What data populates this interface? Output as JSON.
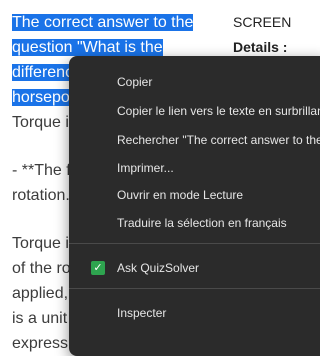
{
  "content": {
    "selected_lines": [
      "The correct answer to the",
      "question \"What is the",
      "differenc",
      "horsepo"
    ],
    "body_lines": [
      "Torque is",
      "- **The f",
      "rotation.",
      "Torque is",
      "of the ro",
      "applied,",
      "is a unit",
      "express the rate at which"
    ]
  },
  "right_column": {
    "label": "SCREEN",
    "details": "Details :"
  },
  "context_menu": {
    "items": [
      "Copier",
      "Copier le lien vers le texte en surbrillance",
      "Rechercher \"The correct answer to the...\"",
      "Imprimer...",
      "Ouvrir en mode Lecture",
      "Traduire la sélection en français",
      "Ask QuizSolver",
      "Inspecter"
    ],
    "accent_color": "#2ea44f"
  },
  "colors": {
    "selection": "#1a73e8",
    "menu_background": "#2b2b2b"
  }
}
